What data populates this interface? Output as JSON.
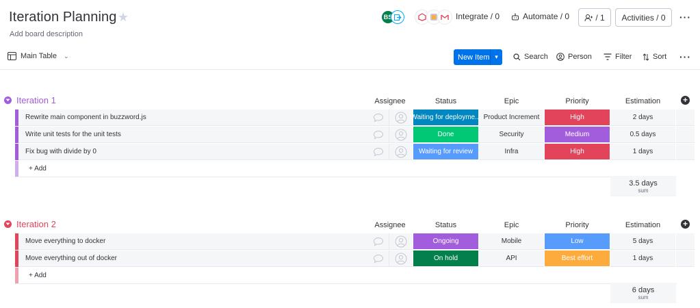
{
  "header": {
    "title": "Iteration Planning",
    "description": "Add board description",
    "member_initials": "BS",
    "integrate_label": "Integrate / 0",
    "automate_label": "Automate / 0",
    "members_count": "/ 1",
    "activities_label": "Activities / 0"
  },
  "toolbar": {
    "view_label": "Main Table",
    "new_item_label": "New Item",
    "search_label": "Search",
    "person_label": "Person",
    "filter_label": "Filter",
    "sort_label": "Sort"
  },
  "columns": {
    "assignee": "Assignee",
    "status": "Status",
    "epic": "Epic",
    "priority": "Priority",
    "estimation": "Estimation"
  },
  "colors": {
    "accent": "#0073ea",
    "group1": "#a25ddc",
    "group2": "#e2445c",
    "status_working": "#0086c0",
    "status_done": "#00c875",
    "status_review": "#579bfc",
    "status_ongoing": "#a25ddc",
    "status_onhold": "#037f4c",
    "prio_high": "#e2445c",
    "prio_medium": "#a25ddc",
    "prio_low": "#579bfc",
    "prio_best": "#fdab3d"
  },
  "groups": [
    {
      "title": "Iteration 1",
      "add_label": "+ Add",
      "sum_value": "3.5 days",
      "sum_label": "sum",
      "rows": [
        {
          "name": "Rewrite main component in buzzword.js",
          "status": "Waiting for deployme...",
          "epic": "Product Increment",
          "priority": "High",
          "estimation": "2 days"
        },
        {
          "name": "Write unit tests for the unit tests",
          "status": "Done",
          "epic": "Security",
          "priority": "Medium",
          "estimation": "0.5 days"
        },
        {
          "name": "Fix bug with divide by 0",
          "status": "Waiting for review",
          "epic": "Infra",
          "priority": "High",
          "estimation": "1 days"
        }
      ]
    },
    {
      "title": "Iteration 2",
      "add_label": "+ Add",
      "sum_value": "6 days",
      "sum_label": "sum",
      "rows": [
        {
          "name": "Move everything to docker",
          "status": "Ongoing",
          "epic": "Mobile",
          "priority": "Low",
          "estimation": "5 days"
        },
        {
          "name": "Move everything out of docker",
          "status": "On hold",
          "epic": "API",
          "priority": "Best effort",
          "estimation": "1 days"
        }
      ]
    }
  ]
}
